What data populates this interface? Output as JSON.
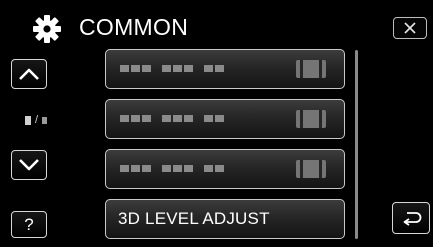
{
  "header": {
    "icon": "gear-icon",
    "title": "COMMON"
  },
  "controls": {
    "close_icon": "close-icon",
    "up_icon": "chevron-up-icon",
    "down_icon": "chevron-down-icon",
    "help_label": "?",
    "page_indicator_icon": "page-indicator-icon",
    "back_icon": "return-icon"
  },
  "menu": {
    "items": [
      {
        "placeholder": true
      },
      {
        "placeholder": true
      },
      {
        "placeholder": true
      },
      {
        "label": "3D LEVEL ADJUST"
      }
    ]
  },
  "colors": {
    "background": "#000000",
    "button_border": "#d7d7d7",
    "text": "#ffffff"
  }
}
